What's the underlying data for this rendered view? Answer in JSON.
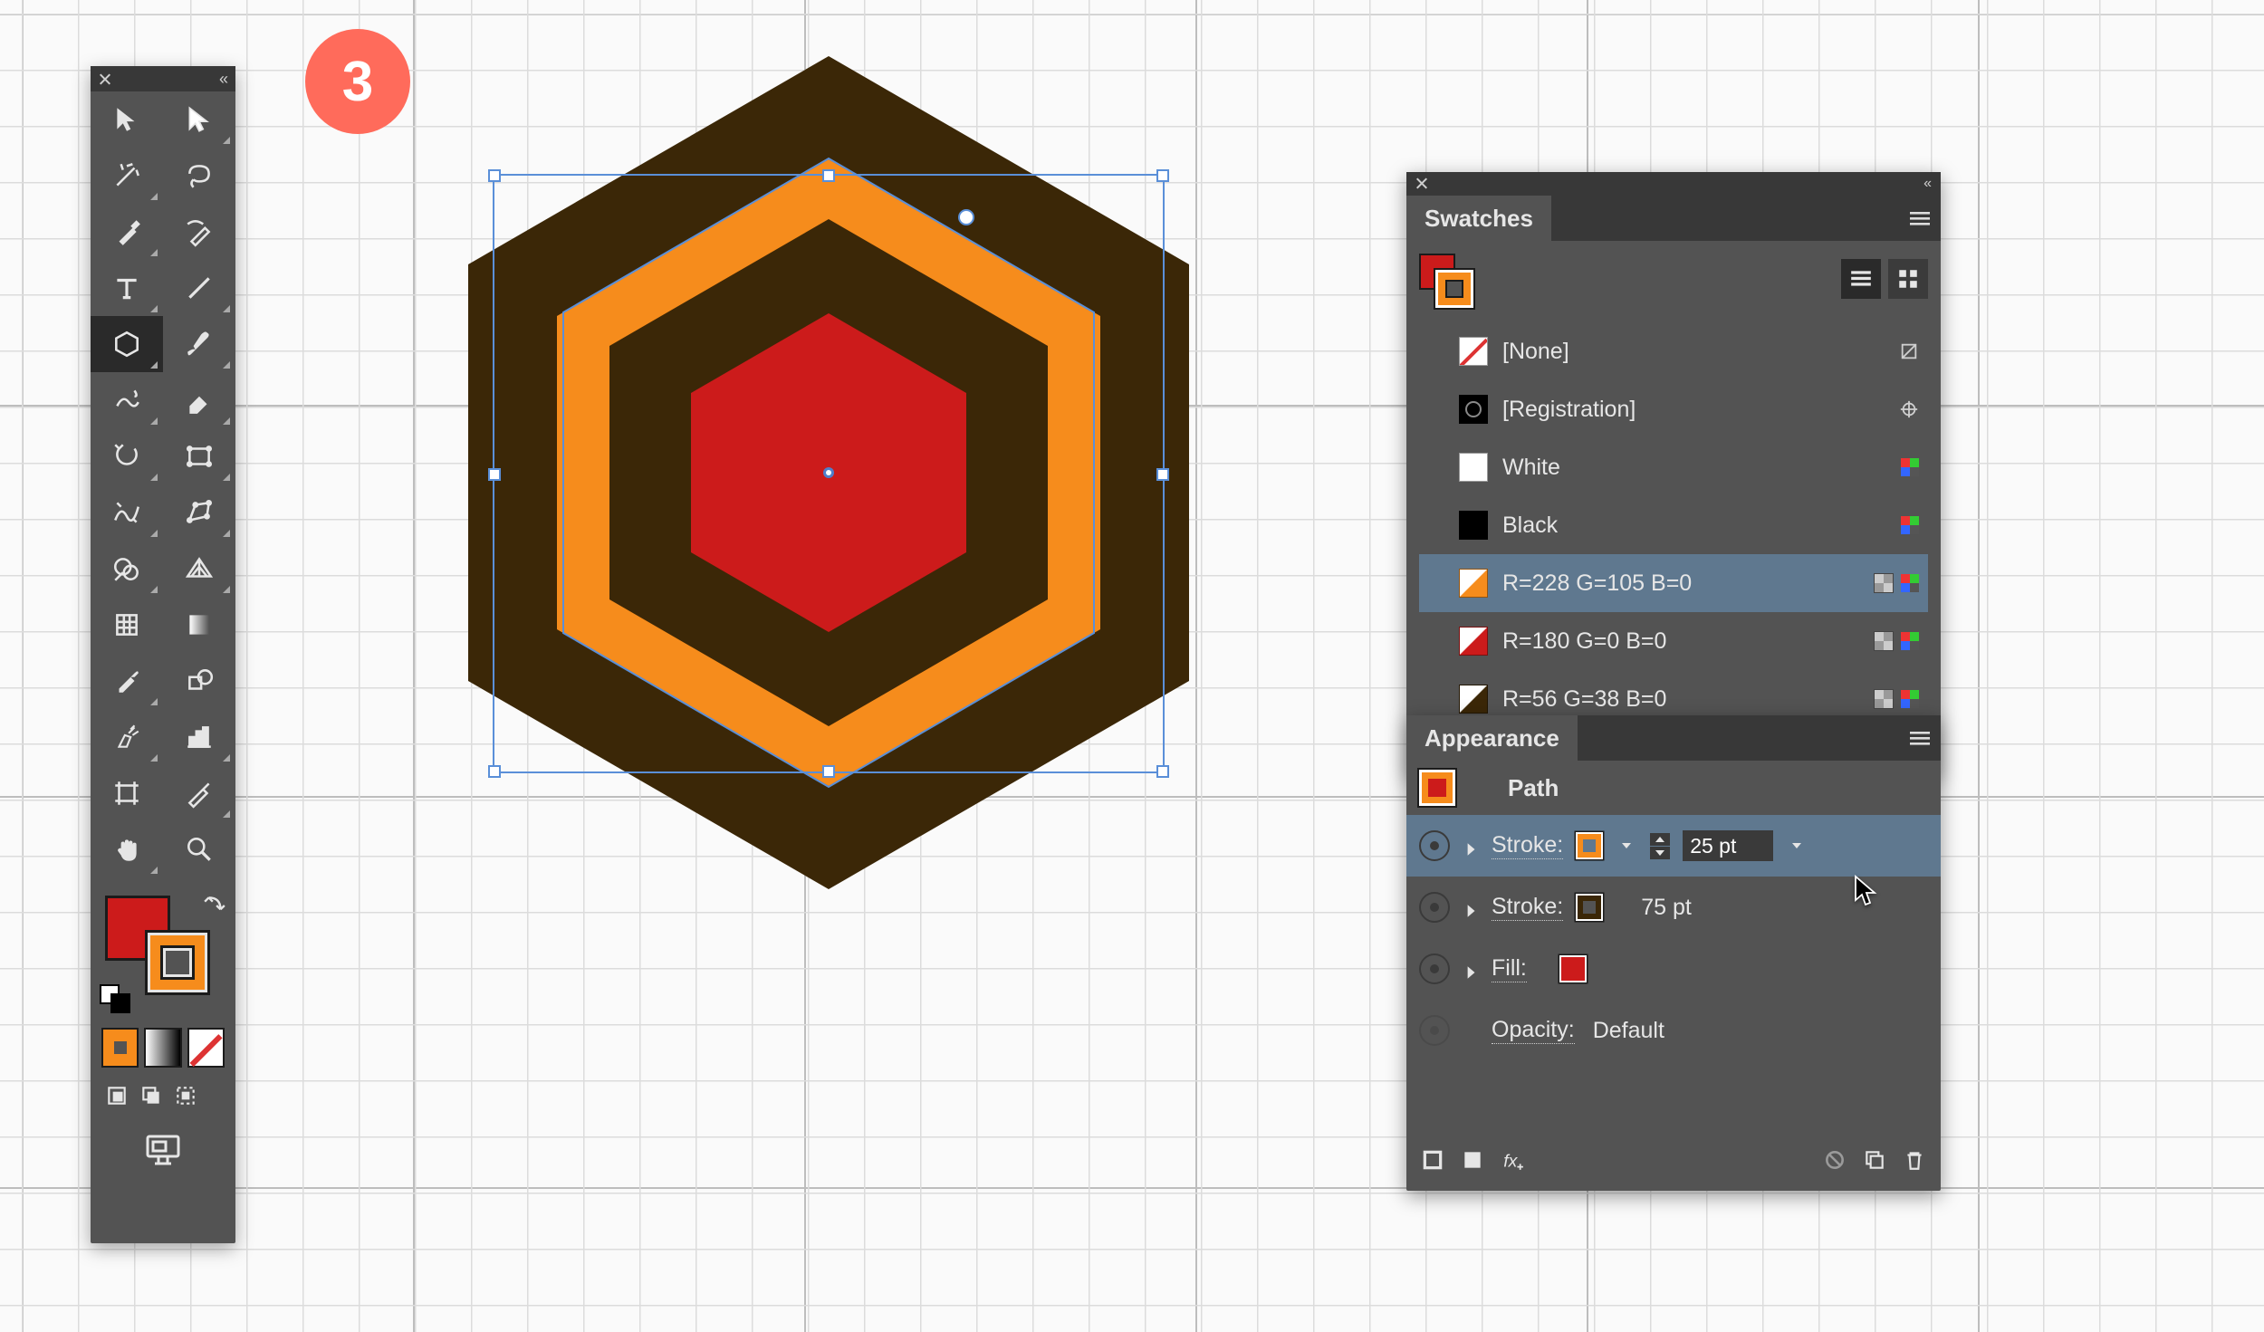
{
  "colors": {
    "orange": "#F68C1C",
    "brown": "#3B2707",
    "red": "#CC1B1B",
    "white": "#FFFFFF",
    "black": "#000000"
  },
  "step_badge": {
    "number": "3"
  },
  "tools": [
    {
      "name": "selection-tool"
    },
    {
      "name": "direct-selection-tool"
    },
    {
      "name": "magic-wand-tool"
    },
    {
      "name": "lasso-tool"
    },
    {
      "name": "pen-tool"
    },
    {
      "name": "curvature-tool"
    },
    {
      "name": "type-tool"
    },
    {
      "name": "line-segment-tool"
    },
    {
      "name": "polygon-tool",
      "selected": true
    },
    {
      "name": "paintbrush-tool"
    },
    {
      "name": "shaper-tool"
    },
    {
      "name": "eraser-tool"
    },
    {
      "name": "rotate-tool"
    },
    {
      "name": "reflect-tool"
    },
    {
      "name": "width-tool"
    },
    {
      "name": "free-transform-tool"
    },
    {
      "name": "shape-builder-tool"
    },
    {
      "name": "perspective-grid-tool"
    },
    {
      "name": "mesh-tool"
    },
    {
      "name": "gradient-tool"
    },
    {
      "name": "eyedropper-tool"
    },
    {
      "name": "blend-tool"
    },
    {
      "name": "symbol-sprayer-tool"
    },
    {
      "name": "column-graph-tool"
    },
    {
      "name": "artboard-tool"
    },
    {
      "name": "slice-tool"
    },
    {
      "name": "hand-tool"
    },
    {
      "name": "zoom-tool"
    }
  ],
  "fill_preview_color": "#CC1B1B",
  "stroke_preview_color": "#F68C1C",
  "panels": {
    "swatches": {
      "title": "Swatches",
      "items": [
        {
          "label": "[None]",
          "type": "none",
          "flags": [
            "target"
          ]
        },
        {
          "label": "[Registration]",
          "type": "reg",
          "flags": [
            "grid"
          ]
        },
        {
          "label": "White",
          "type": "color",
          "hex": "#FFFFFF",
          "flags": [
            "rgb"
          ]
        },
        {
          "label": "Black",
          "type": "color",
          "hex": "#000000",
          "flags": [
            "rgb"
          ]
        },
        {
          "label": "R=228 G=105 B=0",
          "type": "color",
          "hex": "#F68C1C",
          "flags": [
            "global",
            "rgb"
          ],
          "selected": true,
          "half": true
        },
        {
          "label": "R=180 G=0 B=0",
          "type": "color",
          "hex": "#CC1B1B",
          "flags": [
            "global",
            "rgb"
          ],
          "half": true
        },
        {
          "label": "R=56 G=38 B=0",
          "type": "color",
          "hex": "#3B2707",
          "flags": [
            "global",
            "rgb"
          ],
          "half": true
        }
      ]
    },
    "appearance": {
      "title": "Appearance",
      "object_label": "Path",
      "rows": {
        "stroke1": {
          "label": "Stroke:",
          "weight": "25 pt",
          "color": "#F68C1C",
          "selected": true
        },
        "stroke2": {
          "label": "Stroke:",
          "weight": "75 pt",
          "color": "#3B2707"
        },
        "fill": {
          "label": "Fill:",
          "color": "#CC1B1B"
        },
        "opacity": {
          "label": "Opacity:",
          "value": "Default"
        }
      }
    }
  }
}
